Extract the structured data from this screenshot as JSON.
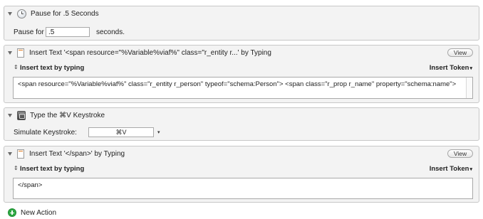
{
  "actions": [
    {
      "title": "Pause for .5 Seconds",
      "icon": "clock-icon",
      "pause_label": "Pause for",
      "pause_value": ".5",
      "pause_unit": "seconds."
    },
    {
      "title": "Insert Text '<span resource=\"%Variable%viaf%\" class=\"r_entity r...' by Typing",
      "icon": "document-icon",
      "view_label": "View",
      "mode_label": "Insert text by typing",
      "token_label": "Insert Token",
      "text": "<span resource=\"%Variable%viaf%\" class=\"r_entity r_person\" typeof=\"schema:Person\"> <span class=\"r_prop r_name\" property=\"schema:name\">"
    },
    {
      "title": "Type the ⌘V Keystroke",
      "icon": "keyboard-icon",
      "simulate_label": "Simulate Keystroke:",
      "keystroke_value": "⌘V"
    },
    {
      "title": "Insert Text '</span>' by Typing",
      "icon": "document-icon",
      "view_label": "View",
      "mode_label": "Insert text by typing",
      "token_label": "Insert Token",
      "text": "</span>"
    }
  ],
  "new_action_label": "New Action",
  "colors": {
    "panel_bg": "#f3f3f3",
    "border": "#c7c7c7",
    "add_green": "#2ea843"
  }
}
